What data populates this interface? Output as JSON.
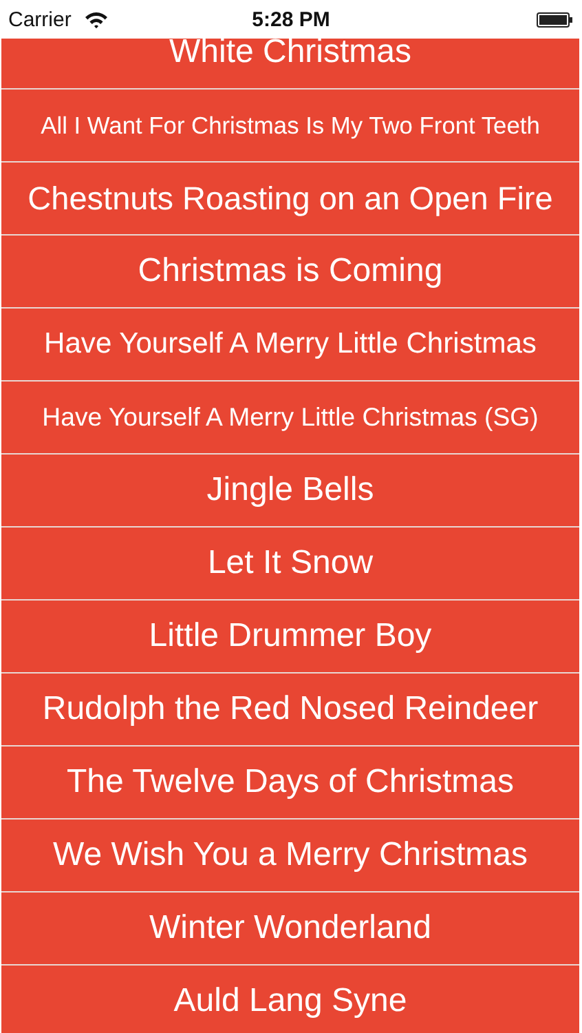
{
  "status_bar": {
    "carrier": "Carrier",
    "time": "5:28 PM"
  },
  "songs": [
    "White Christmas",
    "All I Want For Christmas Is My Two Front Teeth",
    "Chestnuts Roasting on an Open Fire",
    "Christmas is Coming",
    "Have Yourself A Merry Little Christmas",
    "Have Yourself A Merry Little Christmas (SG)",
    "Jingle Bells",
    "Let It Snow",
    "Little Drummer Boy",
    "Rudolph the Red Nosed Reindeer",
    "The Twelve Days of Christmas",
    "We Wish You a Merry Christmas",
    "Winter Wonderland",
    "Auld Lang Syne"
  ]
}
